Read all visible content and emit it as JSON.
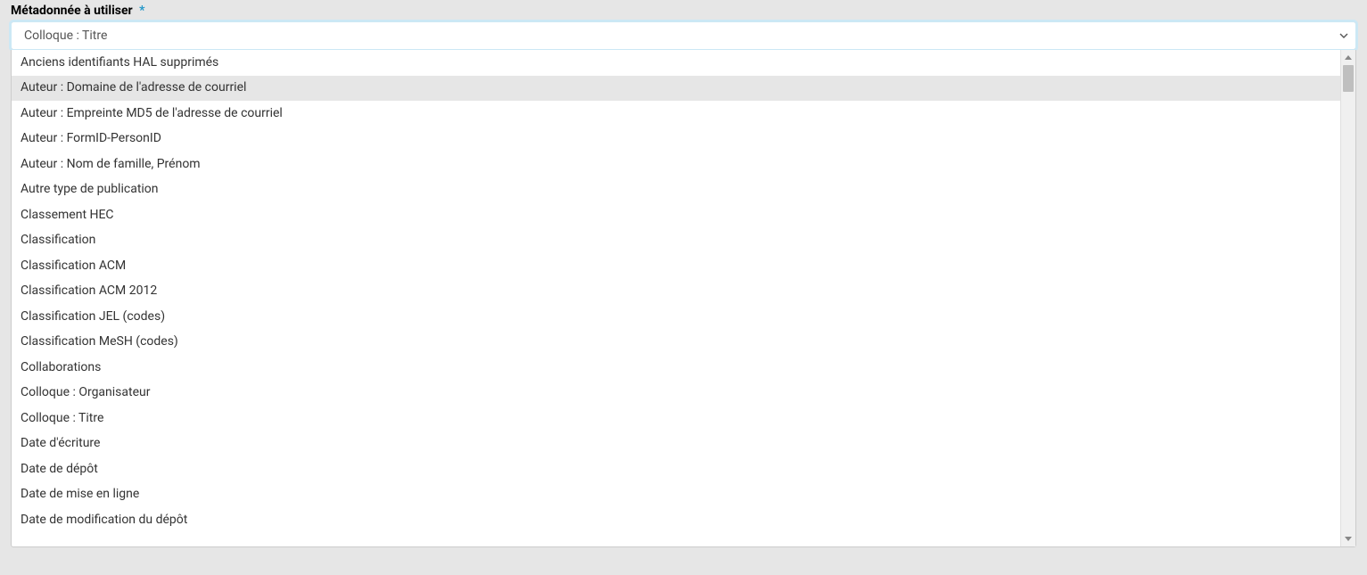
{
  "field": {
    "label": "Métadonnée à utiliser",
    "required_marker": "*",
    "selected_value": "Colloque : Titre"
  },
  "options": [
    {
      "label": "Anciens identifiants HAL supprimés",
      "highlighted": false
    },
    {
      "label": "Auteur : Domaine de l'adresse de courriel",
      "highlighted": true
    },
    {
      "label": "Auteur : Empreinte MD5 de l'adresse de courriel",
      "highlighted": false
    },
    {
      "label": "Auteur : FormID-PersonID",
      "highlighted": false
    },
    {
      "label": "Auteur : Nom de famille, Prénom",
      "highlighted": false
    },
    {
      "label": "Autre type de publication",
      "highlighted": false
    },
    {
      "label": "Classement HEC",
      "highlighted": false
    },
    {
      "label": "Classification",
      "highlighted": false
    },
    {
      "label": "Classification ACM",
      "highlighted": false
    },
    {
      "label": "Classification ACM 2012",
      "highlighted": false
    },
    {
      "label": "Classification JEL (codes)",
      "highlighted": false
    },
    {
      "label": "Classification MeSH (codes)",
      "highlighted": false
    },
    {
      "label": "Collaborations",
      "highlighted": false
    },
    {
      "label": "Colloque : Organisateur",
      "highlighted": false
    },
    {
      "label": "Colloque : Titre",
      "highlighted": false
    },
    {
      "label": "Date d'écriture",
      "highlighted": false
    },
    {
      "label": "Date de dépôt",
      "highlighted": false
    },
    {
      "label": "Date de mise en ligne",
      "highlighted": false
    },
    {
      "label": "Date de modification du dépôt",
      "highlighted": false
    }
  ]
}
